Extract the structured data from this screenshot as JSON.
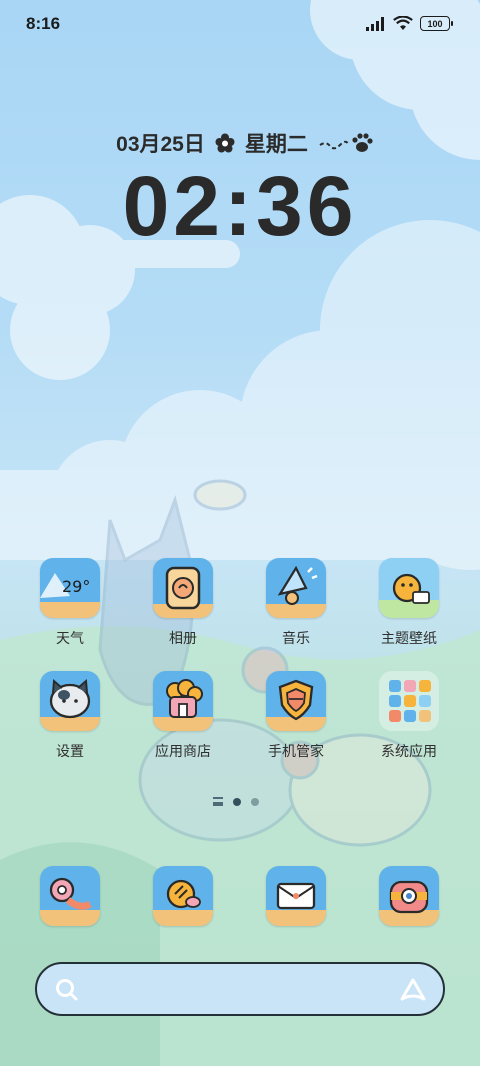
{
  "status_bar": {
    "time": "8:16",
    "battery": "100"
  },
  "clock": {
    "date": "03月25日",
    "weekday": "星期二",
    "time": "02:36"
  },
  "apps_row1": [
    {
      "label": "天气",
      "temp": "29°",
      "icon": "weather-icon"
    },
    {
      "label": "相册",
      "icon": "gallery-icon"
    },
    {
      "label": "音乐",
      "icon": "music-icon"
    },
    {
      "label": "主题壁纸",
      "icon": "themes-icon"
    }
  ],
  "apps_row2": [
    {
      "label": "设置",
      "icon": "settings-icon"
    },
    {
      "label": "应用商店",
      "icon": "app-store-icon"
    },
    {
      "label": "手机管家",
      "icon": "security-icon"
    },
    {
      "label": "系统应用",
      "icon": "system-apps-folder-icon"
    }
  ],
  "dock": [
    {
      "icon": "phone-icon"
    },
    {
      "icon": "messages-icon"
    },
    {
      "icon": "mail-icon"
    },
    {
      "icon": "camera-icon"
    }
  ],
  "colors": {
    "icon_sky": "#4fa9e8",
    "icon_sand": "#f3c27a",
    "text": "#2f2f2f"
  }
}
